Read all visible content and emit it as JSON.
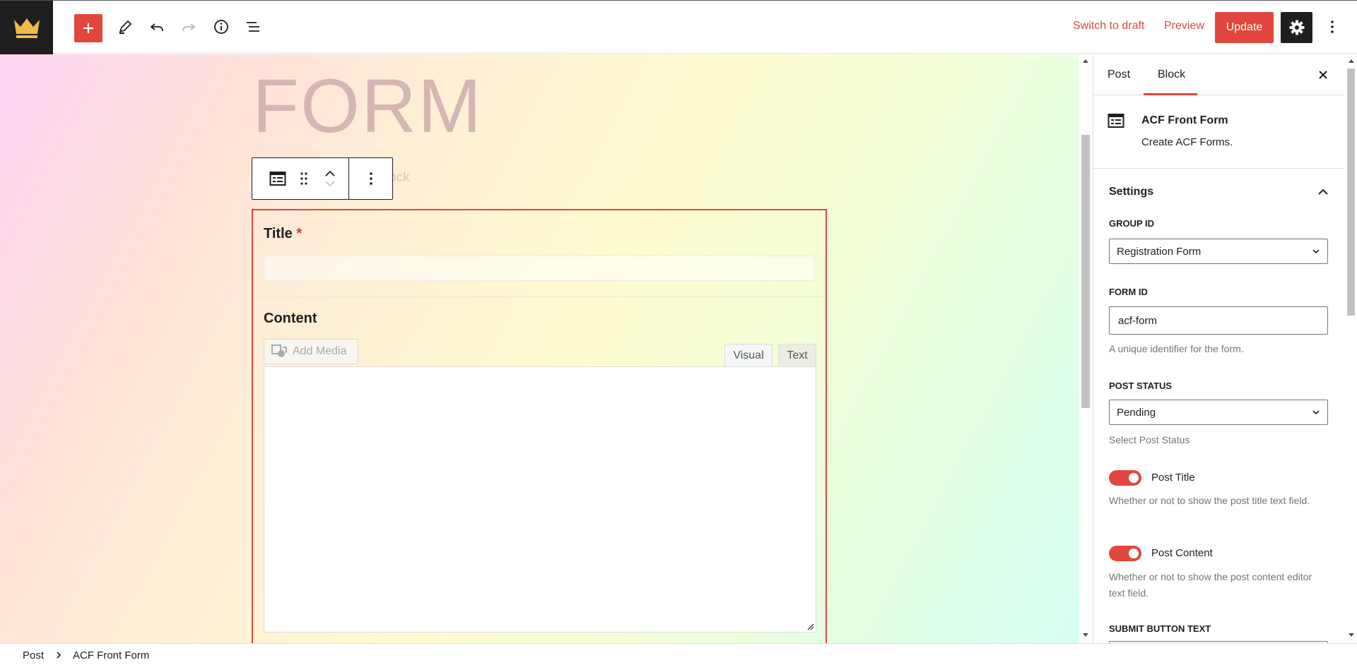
{
  "topbar": {
    "switch_to_draft": "Switch to draft",
    "preview": "Preview",
    "update": "Update",
    "icons": [
      "crown-logo-icon",
      "plus-icon",
      "pencil-icon",
      "undo-icon",
      "redo-icon",
      "info-icon",
      "list-view-icon",
      "gear-icon",
      "more-vertical-icon"
    ]
  },
  "canvas": {
    "hero_title": "FORM",
    "ghost_text": "ock",
    "form": {
      "title_label": "Title",
      "required_mark": "*",
      "content_label": "Content",
      "add_media": "Add Media",
      "tab_visual": "Visual",
      "tab_text": "Text"
    }
  },
  "sidebar": {
    "tab_post": "Post",
    "tab_block": "Block",
    "active_tab": "Block",
    "block_name": "ACF Front Form",
    "block_desc": "Create ACF Forms.",
    "settings_heading": "Settings",
    "group_id_label": "GROUP ID",
    "group_id_value": "Registration Form",
    "form_id_label": "FORM ID",
    "form_id_value": "acf-form",
    "form_id_help": "A unique identifier for the form.",
    "post_status_label": "POST STATUS",
    "post_status_value": "Pending",
    "post_status_help": "Select Post Status",
    "post_title_toggle": "Post Title",
    "post_title_on": true,
    "post_title_help": "Whether or not to show the post title text field.",
    "post_content_toggle": "Post Content",
    "post_content_on": true,
    "post_content_help": "Whether or not to show the post content editor text field.",
    "submit_label": "SUBMIT BUTTON TEXT"
  },
  "footer": {
    "crumb_post": "Post",
    "crumb_block": "ACF Front Form"
  },
  "colors": {
    "accent": "#e2473d",
    "dark": "#1e1e1e"
  }
}
